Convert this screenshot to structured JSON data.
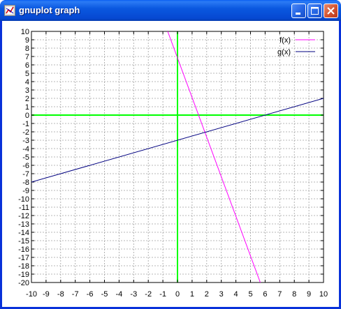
{
  "window": {
    "title": "gnuplot graph",
    "icon": "gnuplot-app-icon",
    "controls": [
      "minimize-icon",
      "maximize-icon",
      "close-icon"
    ]
  },
  "colors": {
    "titlebar": "#0a58e0",
    "axis_zero_lines": "#00ff00",
    "grid": "#a0a0a0",
    "f_line": "#ff00ff",
    "g_line": "#000080"
  },
  "chart_data": {
    "type": "line",
    "title": "",
    "xlabel": "",
    "ylabel": "",
    "xlim": [
      -10,
      10
    ],
    "ylim": [
      -20,
      10
    ],
    "xticks": [
      "-10",
      "-9",
      "-8",
      "-7",
      "-6",
      "-5",
      "-4",
      "-3",
      "-2",
      "-1",
      "0",
      "1",
      "2",
      "3",
      "4",
      "5",
      "6",
      "7",
      "8",
      "9",
      "10"
    ],
    "yticks": [
      "10",
      "9",
      "8",
      "7",
      "6",
      "5",
      "4",
      "3",
      "2",
      "1",
      "0",
      "-1",
      "-2",
      "-3",
      "-4",
      "-5",
      "-6",
      "-7",
      "-8",
      "-9",
      "-10",
      "-11",
      "-12",
      "-13",
      "-14",
      "-15",
      "-16",
      "-17",
      "-18",
      "-19",
      "-20"
    ],
    "grid": true,
    "zero_axes": true,
    "legend_position": "top-right",
    "series": [
      {
        "name": "f(x)",
        "color": "#ff00ff",
        "x": [
          -0.67,
          5.67
        ],
        "y": [
          10,
          -20
        ]
      },
      {
        "name": "g(x)",
        "color": "#000080",
        "x": [
          -10,
          10
        ],
        "y": [
          -8,
          2
        ]
      }
    ]
  }
}
